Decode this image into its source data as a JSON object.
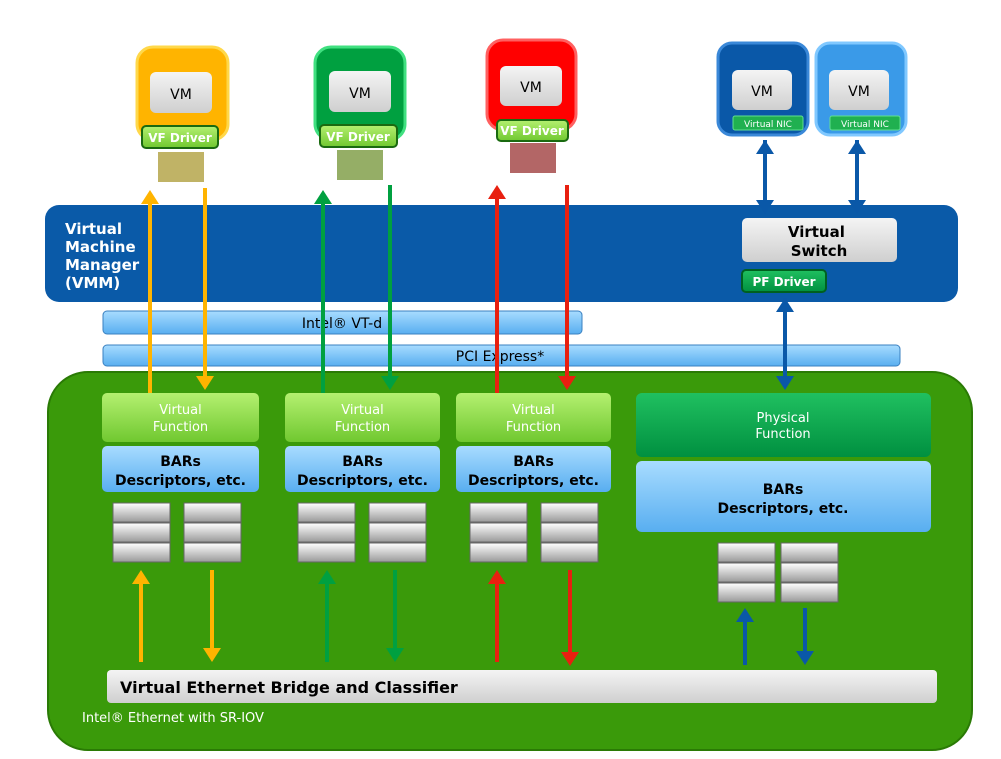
{
  "colors": {
    "yellow": "#ffb400",
    "green": "#00a040",
    "red": "#ff0000",
    "dark_blue": "#0a58a8",
    "light_blue": "#3a9ae8",
    "vmm": "#0a5aa8",
    "adapter": "#3a9a0a",
    "bar": "#7cc4f4"
  },
  "vms": [
    {
      "label": "VM",
      "driver": "VF Driver",
      "color": "yellow"
    },
    {
      "label": "VM",
      "driver": "VF Driver",
      "color": "green"
    },
    {
      "label": "VM",
      "driver": "VF Driver",
      "color": "red"
    },
    {
      "label": "VM",
      "driver": "Virtual NIC",
      "color": "dark_blue"
    },
    {
      "label": "VM",
      "driver": "Virtual NIC",
      "color": "light_blue"
    }
  ],
  "vmm": {
    "lines": [
      "Virtual",
      "Machine",
      "Manager",
      "(VMM)"
    ],
    "switch_lines": [
      "Virtual",
      "Switch"
    ],
    "pf_driver": "PF Driver"
  },
  "vtd": "Intel® VT-d",
  "pcie": "PCI Express*",
  "functions": [
    {
      "lines": [
        "Virtual",
        "Function"
      ],
      "bars": [
        "BARs",
        "Descriptors, etc."
      ]
    },
    {
      "lines": [
        "Virtual",
        "Function"
      ],
      "bars": [
        "BARs",
        "Descriptors, etc."
      ]
    },
    {
      "lines": [
        "Virtual",
        "Function"
      ],
      "bars": [
        "BARs",
        "Descriptors, etc."
      ]
    },
    {
      "lines": [
        "Physical",
        "Function"
      ],
      "bars": [
        "BARs",
        "Descriptors, etc."
      ]
    }
  ],
  "bridge": "Virtual Ethernet Bridge and Classifier",
  "adapter_label": "Intel® Ethernet with SR-IOV"
}
